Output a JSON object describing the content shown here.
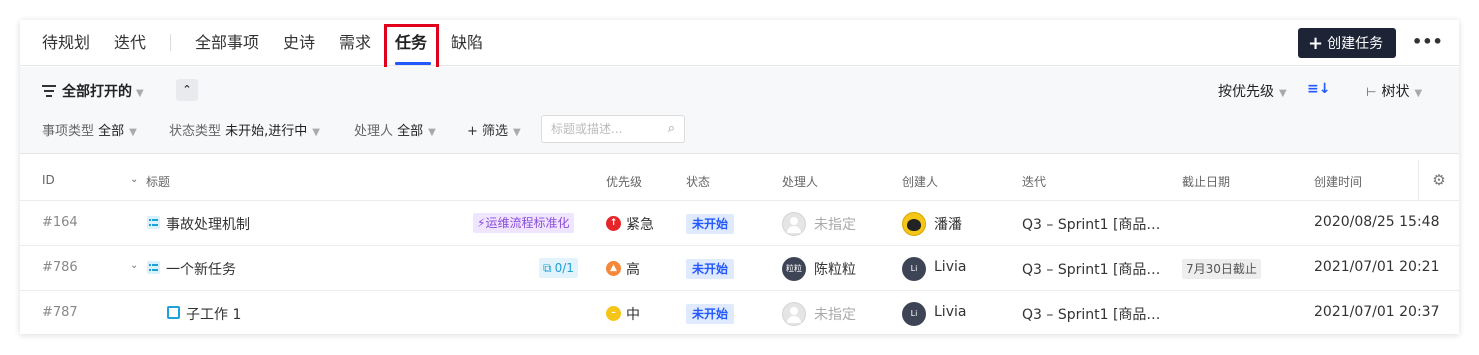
{
  "nav": {
    "tabs": [
      "待规划",
      "迭代",
      "全部事项",
      "史诗",
      "需求",
      "任务",
      "缺陷"
    ],
    "active_tab": "任务",
    "create_button": "创建任务",
    "more_label": "•••"
  },
  "toolbar": {
    "view_label": "全部打开的",
    "sort_label": "按优先级",
    "tree_label": "树状"
  },
  "filters": {
    "type_label": "事项类型",
    "type_value": "全部",
    "status_label": "状态类型",
    "status_value": "未开始,进行中",
    "assignee_label": "处理人",
    "assignee_value": "全部",
    "add_filter": "+ 筛选",
    "search_placeholder": "标题或描述..."
  },
  "table": {
    "columns": {
      "id": "ID",
      "title": "标题",
      "priority": "优先级",
      "status": "状态",
      "assignee": "处理人",
      "creator": "创建人",
      "iteration": "迭代",
      "due": "截止日期",
      "created": "创建时间"
    },
    "rows": [
      {
        "id": "#164",
        "title": "事故处理机制",
        "epic_tag": "运维流程标准化",
        "priority": "紧急",
        "status": "未开始",
        "assignee": "未指定",
        "creator": "潘潘",
        "iteration": "Q3 – Sprint1 [商品…",
        "due": "",
        "created": "2020/08/25 15:48"
      },
      {
        "id": "#786",
        "title": "一个新任务",
        "subtask_count": "0/1",
        "priority": "高",
        "status": "未开始",
        "assignee": "陈粒粒",
        "assignee_avatar": "粒粒",
        "creator": "Livia",
        "creator_avatar": "Li",
        "iteration": "Q3 – Sprint1 [商品…",
        "due": "7月30日截止",
        "created": "2021/07/01 20:21"
      },
      {
        "id": "#787",
        "title": "子工作 1",
        "priority": "中",
        "status": "未开始",
        "assignee": "未指定",
        "creator": "Livia",
        "creator_avatar": "Li",
        "iteration": "Q3 – Sprint1 [商品…",
        "due": "",
        "created": "2021/07/01 20:37"
      }
    ]
  },
  "colors": {
    "accent": "#2458ff",
    "urgent": "#e5252a",
    "high": "#f5883a",
    "medium": "#f5c518",
    "highlight": "#e0001b"
  }
}
